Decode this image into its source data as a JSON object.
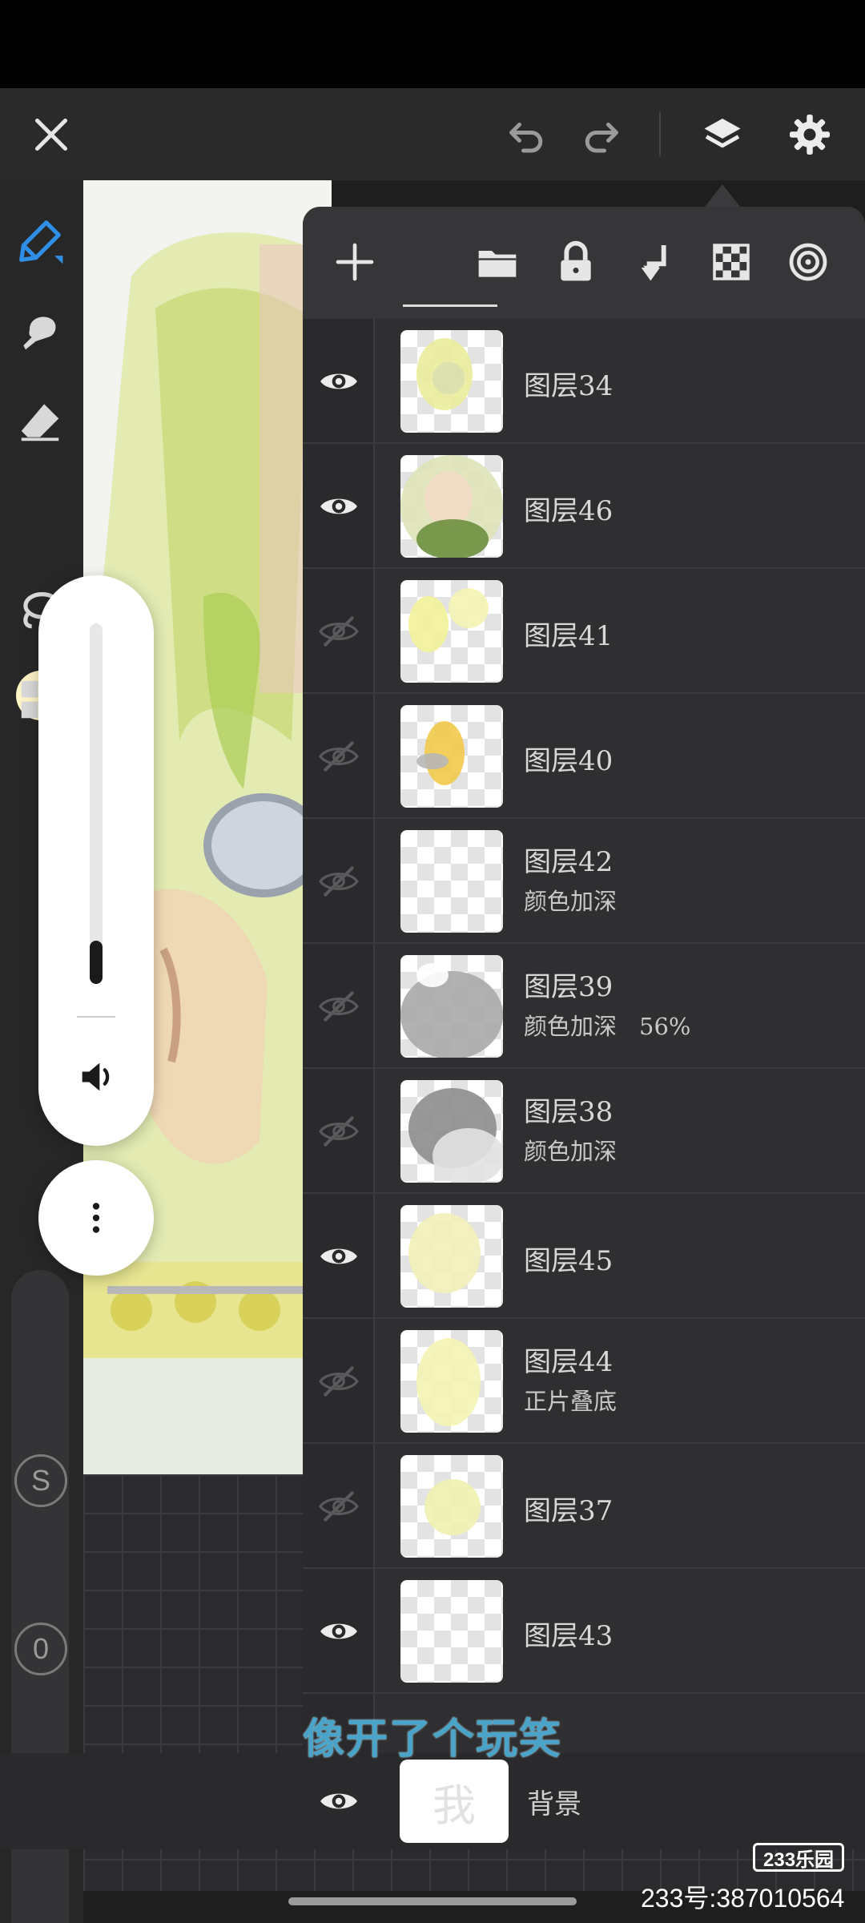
{
  "topbar": {
    "icons": [
      "close-icon",
      "undo-icon",
      "redo-icon",
      "layers-icon",
      "gear-icon"
    ]
  },
  "left_toolbar": {
    "icons": [
      "pen-icon",
      "smudge-icon",
      "eraser-icon",
      "color-swatch",
      "lasso-icon",
      "grid-icon"
    ],
    "color": "#fdf4c5",
    "size_label": "S",
    "opacity_label": "0"
  },
  "volume": {
    "level": 0.12
  },
  "layers_toolbar": {
    "icons": [
      "add-layer-icon",
      "folder-icon",
      "lock-icon",
      "merge-down-icon",
      "transparency-icon",
      "clipping-icon"
    ]
  },
  "layers": [
    {
      "name": "图层34",
      "mode": "",
      "opacity": "",
      "visible": true
    },
    {
      "name": "图层46",
      "mode": "",
      "opacity": "",
      "visible": true
    },
    {
      "name": "图层41",
      "mode": "",
      "opacity": "",
      "visible": false
    },
    {
      "name": "图层40",
      "mode": "",
      "opacity": "",
      "visible": false
    },
    {
      "name": "图层42",
      "mode": "颜色加深",
      "opacity": "",
      "visible": false
    },
    {
      "name": "图层39",
      "mode": "颜色加深",
      "opacity": "56%",
      "visible": false
    },
    {
      "name": "图层38",
      "mode": "颜色加深",
      "opacity": "",
      "visible": false
    },
    {
      "name": "图层45",
      "mode": "",
      "opacity": "",
      "visible": true
    },
    {
      "name": "图层44",
      "mode": "正片叠底",
      "opacity": "",
      "visible": false
    },
    {
      "name": "图层37",
      "mode": "",
      "opacity": "",
      "visible": false
    },
    {
      "name": "图层43",
      "mode": "",
      "opacity": "",
      "visible": true
    }
  ],
  "background_layer": {
    "name": "背景",
    "thumb_text": "我",
    "visible": true
  },
  "subtitle": "像开了个玩笑",
  "watermark": {
    "logo": "233乐园",
    "id": "233号:387010564"
  },
  "colors": {
    "accent": "#2f8fe6",
    "subtitle": "#4aa3c8",
    "panel": "#2f2f31"
  }
}
